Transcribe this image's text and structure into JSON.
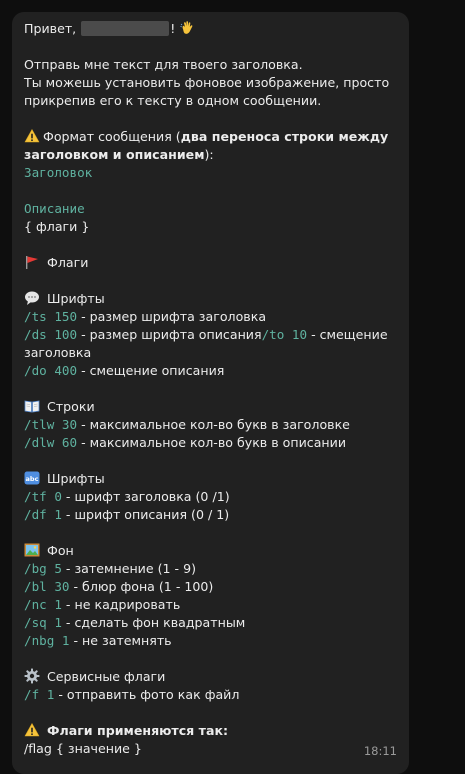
{
  "message": {
    "greeting_prefix": "Привет,",
    "greeting_suffix": "!",
    "intro_1": "Отправь мне текст для твоего заголовка.",
    "intro_2": "Ты можешь установить фоновое изображение, просто",
    "intro_3": "прикрепив его к тексту в одном сообщении.",
    "format_title_prefix": "Формат сообщения (",
    "format_title_bold": "два переноса строки между",
    "format_title_bold_2": "заголовком и описанием",
    "format_title_suffix": "):",
    "format_header": "Заголовок",
    "format_description": "Описание",
    "format_flags": "{ флаги }",
    "flags_title": "Флаги",
    "fonts_title": "Шрифты",
    "ts_cmd": "/ts 150",
    "ts_text": " - размер шрифта заголовка",
    "ds_cmd": "/ds 100",
    "ds_text": " - размер шрифта описания",
    "to_cmd": "/to 10",
    "to_text": " - смещение",
    "to_text_2": "заголовка",
    "do_cmd": "/do 400",
    "do_text": " - смещение описания",
    "lines_title": "Строки",
    "tlw_cmd": "/tlw 30",
    "tlw_text": " - максимальное кол-во букв в заголовке",
    "dlw_cmd": "/dlw 60",
    "dlw_text": " - максимальное кол-во букв в описании",
    "fonts2_title": "Шрифты",
    "tf_cmd": "/tf 0",
    "tf_text": " - шрифт заголовка (0  /1)",
    "df_cmd": "/df 1",
    "df_text": " - шрифт описания (0 / 1)",
    "bg_title": "Фон",
    "bg_cmd": "/bg 5",
    "bg_text": " - затемнение (1 - 9)",
    "bl_cmd": "/bl 30",
    "bl_text": " - блюр фона (1 - 100)",
    "nc_cmd": "/nc 1",
    "nc_text": " - не кадрировать",
    "sq_cmd": "/sq 1",
    "sq_text": " - сделать фон квадратным",
    "nbg_cmd": "/nbg 1",
    "nbg_text": " - не затемнять",
    "service_title": "Сервисные флаги",
    "f_cmd": "/f 1",
    "f_text": " - отправить фото как файл",
    "apply_title": "Флаги применяются так:",
    "apply_example": "/flag { значение }",
    "time": "18:11"
  },
  "icons": {
    "wave": "waving-hand-icon",
    "warning": "warning-icon",
    "flag": "red-flag-icon",
    "speech": "speech-bubble-icon",
    "book": "open-book-icon",
    "abc": "abc-input-icon",
    "picture": "framed-picture-icon",
    "gear": "gear-icon"
  },
  "colors": {
    "background": "#0e0e0e",
    "bubble": "#212121",
    "text": "#ececec",
    "command": "#5fb2a0",
    "time": "#9a9a9a"
  }
}
